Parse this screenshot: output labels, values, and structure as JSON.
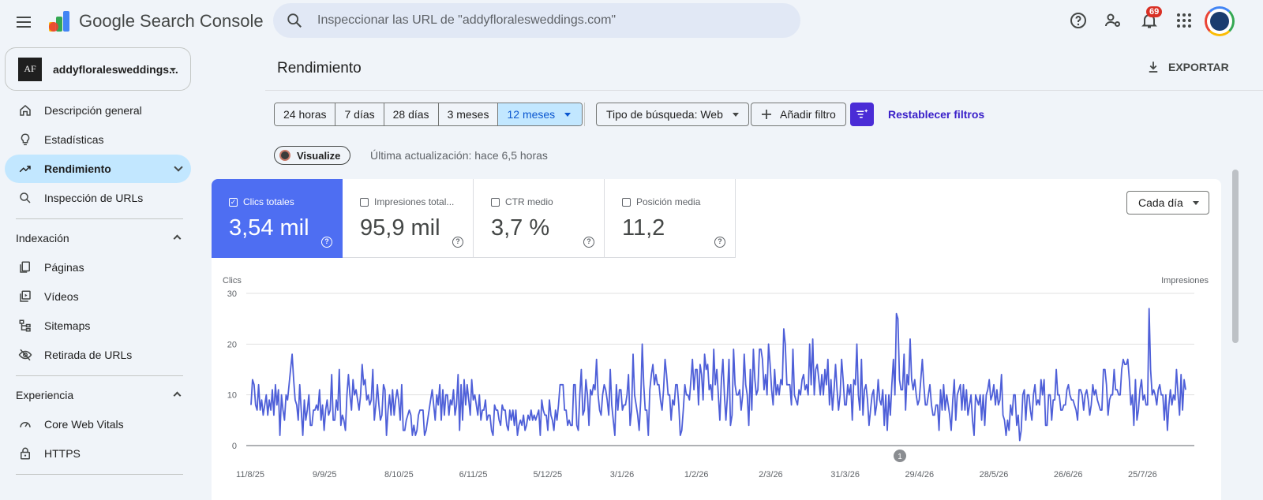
{
  "app": {
    "title": "Google Search Console",
    "search_placeholder": "Inspeccionar las URL de \"addyfloralesweddings.com\"",
    "notification_count": "69"
  },
  "property": {
    "logo_text": "AF",
    "name": "addyfloralesweddings..."
  },
  "sidebar": {
    "items": [
      {
        "label": "Descripción general",
        "icon": "home-icon"
      },
      {
        "label": "Estadísticas",
        "icon": "lightbulb-icon"
      },
      {
        "label": "Rendimiento",
        "icon": "trending-up-icon",
        "active": true
      },
      {
        "label": "Inspección de URLs",
        "icon": "search-icon"
      }
    ],
    "indexacion": {
      "title": "Indexación",
      "items": [
        {
          "label": "Páginas",
          "icon": "pages-icon"
        },
        {
          "label": "Vídeos",
          "icon": "video-icon"
        },
        {
          "label": "Sitemaps",
          "icon": "sitemap-icon"
        },
        {
          "label": "Retirada de URLs",
          "icon": "visibility-off-icon"
        }
      ]
    },
    "experiencia": {
      "title": "Experiencia",
      "items": [
        {
          "label": "Core Web Vitals",
          "icon": "speed-icon"
        },
        {
          "label": "HTTPS",
          "icon": "lock-icon"
        }
      ]
    }
  },
  "main": {
    "title": "Rendimiento",
    "export_label": "EXPORTAR",
    "ranges": [
      "24 horas",
      "7 días",
      "28 días",
      "3 meses",
      "12 meses"
    ],
    "selected_range": "12 meses",
    "search_type": "Tipo de búsqueda: Web",
    "add_filter": "Añadir filtro",
    "reset_filters": "Restablecer filtros",
    "visualize": "Visualize",
    "last_update": "Última actualización: hace 6,5 horas",
    "granularity": "Cada día",
    "annotation_marker": "1"
  },
  "metrics": [
    {
      "label": "Clics totales",
      "value": "3,54 mil",
      "checked": true
    },
    {
      "label": "Impresiones total...",
      "value": "95,9 mil",
      "checked": false
    },
    {
      "label": "CTR medio",
      "value": "3,7 %",
      "checked": false
    },
    {
      "label": "Posición media",
      "value": "11,2",
      "checked": false
    }
  ],
  "colors": {
    "accent": "#4e6ef2",
    "line": "#4e5fd8",
    "selected_range_bg": "#c2e7ff",
    "active_nav_bg": "#c2e7ff",
    "filter_button": "#4a2cd6",
    "badge": "#d93025"
  },
  "chart_data": {
    "type": "line",
    "ylabel": "Clics",
    "y2label": "Impresiones",
    "ylim": [
      0,
      30
    ],
    "yticks": [
      0,
      10,
      20,
      30
    ],
    "xticks": [
      "11/8/25",
      "9/9/25",
      "8/10/25",
      "6/11/25",
      "5/12/25",
      "3/1/26",
      "1/2/26",
      "2/3/26",
      "31/3/26",
      "29/4/26",
      "28/5/26",
      "26/6/26",
      "25/7/26"
    ],
    "grid": true,
    "series": [
      {
        "name": "Clics",
        "values": [
          8,
          13,
          12,
          8,
          7,
          12,
          7,
          9,
          6,
          8,
          10,
          6,
          9,
          7,
          11,
          6,
          12,
          8,
          11,
          2,
          10,
          7,
          5,
          10,
          9,
          12,
          15,
          18,
          13,
          9,
          8,
          5,
          12,
          7,
          2,
          9,
          5,
          7,
          10,
          4,
          4,
          7,
          7,
          8,
          7,
          11,
          5,
          8,
          3,
          7,
          9,
          6,
          7,
          14,
          5,
          5,
          9,
          7,
          15,
          4,
          6,
          5,
          3,
          10,
          14,
          10,
          7,
          13,
          10,
          11,
          9,
          7,
          10,
          16,
          12,
          13,
          9,
          10,
          8,
          9,
          15,
          5,
          8,
          12,
          8,
          5,
          6,
          12,
          11,
          2,
          7,
          10,
          6,
          11,
          6,
          9,
          11,
          9,
          5,
          12,
          3,
          3,
          5,
          6,
          7,
          6,
          2,
          4,
          2,
          3,
          6,
          7,
          7,
          7,
          2,
          3,
          5,
          7,
          9,
          11,
          8,
          5,
          10,
          8,
          12,
          5,
          11,
          6,
          10,
          10,
          6,
          9,
          8,
          11,
          6,
          8,
          14,
          3,
          12,
          5,
          13,
          8,
          12,
          9,
          6,
          13,
          9,
          10,
          8,
          6,
          10,
          5,
          7,
          7,
          9,
          5,
          6,
          6,
          3,
          2,
          8,
          7,
          7,
          5,
          4,
          8,
          7,
          7,
          4,
          3,
          7,
          5,
          7,
          4,
          7,
          2,
          4,
          5,
          4,
          6,
          3,
          4,
          6,
          5,
          7,
          5,
          6,
          5,
          6,
          7,
          2,
          9,
          7,
          6,
          6,
          3,
          9,
          6,
          5,
          3,
          7,
          5,
          8,
          12,
          12,
          12,
          7,
          7,
          4,
          5,
          4,
          4,
          12,
          12,
          4,
          3,
          10,
          15,
          6,
          7,
          13,
          10,
          4,
          11,
          10,
          12,
          11,
          17,
          10,
          7,
          6,
          10,
          12,
          11,
          9,
          6,
          15,
          8,
          5,
          2,
          12,
          7,
          11,
          11,
          7,
          8,
          8,
          10,
          14,
          4,
          7,
          18,
          10,
          8,
          6,
          3,
          9,
          20,
          12,
          7,
          7,
          2,
          11,
          14,
          16,
          12,
          14,
          12,
          12,
          9,
          7,
          11,
          17,
          14,
          10,
          10,
          5,
          9,
          8,
          12,
          12,
          8,
          2,
          3,
          7,
          12,
          10,
          10,
          9,
          13,
          17,
          11,
          15,
          15,
          8,
          16,
          14,
          9,
          18,
          15,
          16,
          11,
          12,
          9,
          19,
          12,
          15,
          10,
          5,
          13,
          17,
          10,
          5,
          10,
          17,
          4,
          6,
          19,
          12,
          10,
          10,
          11,
          7,
          10,
          18,
          12,
          10,
          4,
          15,
          7,
          19,
          13,
          10,
          11,
          19,
          19,
          17,
          11,
          14,
          10,
          20,
          16,
          11,
          8,
          15,
          10,
          12,
          10,
          13,
          12,
          23,
          20,
          12,
          12,
          12,
          8,
          19,
          10,
          9,
          8,
          11,
          10,
          13,
          14,
          11,
          12,
          10,
          20,
          12,
          21,
          10,
          15,
          16,
          13,
          10,
          14,
          10,
          15,
          12,
          17,
          8,
          13,
          7,
          11,
          16,
          11,
          7,
          10,
          17,
          13,
          8,
          8,
          12,
          10,
          12,
          5,
          13,
          12,
          20,
          10,
          7,
          17,
          6,
          11,
          12,
          9,
          4,
          7,
          10,
          11,
          6,
          8,
          13,
          9,
          8,
          11,
          4,
          10,
          3,
          10,
          6,
          12,
          17,
          10,
          26,
          25,
          13,
          11,
          11,
          18,
          7,
          14,
          12,
          21,
          13,
          11,
          13,
          10,
          8,
          9,
          13,
          17,
          12,
          8,
          8,
          10,
          12,
          8,
          6,
          6,
          8,
          8,
          3,
          11,
          7,
          12,
          7,
          10,
          8,
          6,
          3,
          9,
          13,
          5,
          10,
          11,
          12,
          7,
          12,
          7,
          11,
          6,
          8,
          10,
          5,
          2,
          10,
          9,
          8,
          10,
          5,
          10,
          4,
          10,
          11,
          13,
          9,
          10,
          12,
          8,
          11,
          8,
          9,
          14,
          6,
          5,
          2,
          5,
          3,
          8,
          6,
          10,
          10,
          4,
          6,
          1,
          3,
          10,
          11,
          5,
          10,
          10,
          7,
          5,
          10,
          12,
          8,
          9,
          8,
          13,
          10,
          13,
          4,
          4,
          10,
          10,
          5,
          9,
          9,
          15,
          10,
          10,
          7,
          7,
          8,
          8,
          11,
          12,
          10,
          9,
          9,
          8,
          7,
          5,
          11,
          11,
          10,
          7,
          10,
          11,
          9,
          6,
          8,
          12,
          10,
          11,
          9,
          8,
          7,
          7,
          15,
          15,
          12,
          6,
          9,
          10,
          10,
          15,
          11,
          11,
          10,
          10,
          15,
          17,
          16,
          16,
          17,
          13,
          8,
          10,
          4,
          13,
          5,
          7,
          11,
          13,
          9,
          10,
          8,
          8,
          27,
          15,
          10,
          11,
          10,
          8,
          11,
          12,
          10,
          10,
          5,
          10,
          3,
          8,
          11,
          8,
          10,
          9,
          15,
          10,
          6,
          14,
          7,
          13,
          11
        ]
      }
    ]
  }
}
